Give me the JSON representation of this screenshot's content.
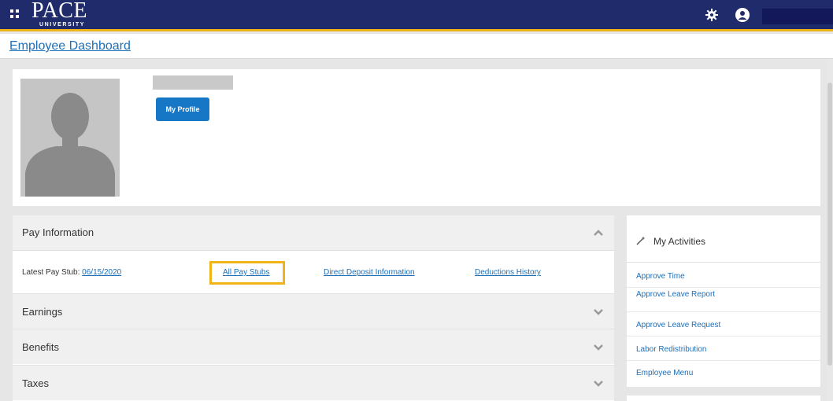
{
  "header": {
    "logo_text": "PACE",
    "logo_subtext": "UNIVERSITY"
  },
  "breadcrumb": {
    "title": "Employee Dashboard"
  },
  "profile": {
    "button_label": "My Profile"
  },
  "pay_information": {
    "title": "Pay Information",
    "latest_stub_label": "Latest Pay Stub:",
    "latest_stub_date": "06/15/2020",
    "links": {
      "all_pay_stubs": "All Pay Stubs",
      "direct_deposit": "Direct Deposit Information",
      "deductions_history": "Deductions History"
    }
  },
  "sections": {
    "earnings": "Earnings",
    "benefits": "Benefits",
    "taxes": "Taxes"
  },
  "activities": {
    "title": "My Activities",
    "items": [
      "Approve Time",
      "Approve Leave Report",
      "Approve Leave Request",
      "Labor Redistribution",
      "Employee Menu"
    ]
  },
  "colors": {
    "header_bg": "#1f2b6b",
    "accent_gold": "#f0b419",
    "link_blue": "#1d6fb8",
    "button_blue": "#1577c5"
  },
  "icons": {
    "apps": "grid-icon",
    "settings": "gear-icon",
    "user": "user-icon",
    "collapse": "chevron-up-icon",
    "expand": "chevron-down-icon",
    "activities": "wand-icon"
  }
}
